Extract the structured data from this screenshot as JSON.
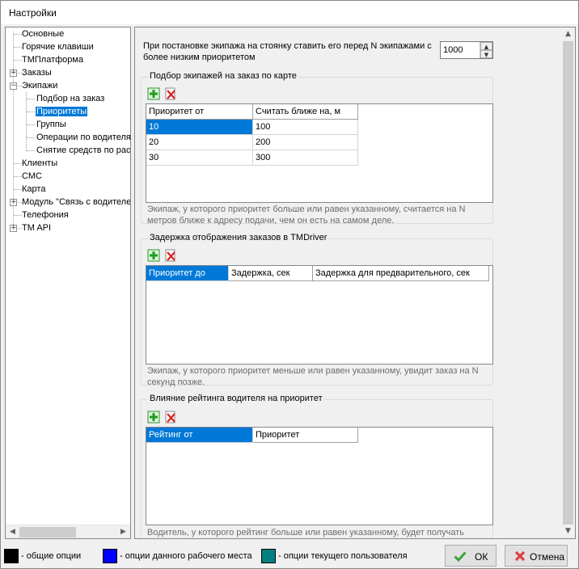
{
  "window": {
    "title": "Настройки"
  },
  "tree": {
    "items": [
      {
        "label": "Основные",
        "depth": 0,
        "expander": ""
      },
      {
        "label": "Горячие клавиши",
        "depth": 0,
        "expander": ""
      },
      {
        "label": "TMПлатформа",
        "depth": 0,
        "expander": ""
      },
      {
        "label": "Заказы",
        "depth": 0,
        "expander": "+"
      },
      {
        "label": "Экипажи",
        "depth": 0,
        "expander": "−"
      },
      {
        "label": "Подбор на заказ",
        "depth": 1,
        "expander": ""
      },
      {
        "label": "Приоритеты",
        "depth": 1,
        "expander": "",
        "selected": true
      },
      {
        "label": "Группы",
        "depth": 1,
        "expander": ""
      },
      {
        "label": "Операции по водителям",
        "depth": 1,
        "expander": ""
      },
      {
        "label": "Снятие средств по расписанию",
        "depth": 1,
        "expander": ""
      },
      {
        "label": "Клиенты",
        "depth": 0,
        "expander": ""
      },
      {
        "label": "СМС",
        "depth": 0,
        "expander": ""
      },
      {
        "label": "Карта",
        "depth": 0,
        "expander": ""
      },
      {
        "label": "Модуль \"Связь с водителем\"",
        "depth": 0,
        "expander": "+"
      },
      {
        "label": "Телефония",
        "depth": 0,
        "expander": ""
      },
      {
        "label": "TM API",
        "depth": 0,
        "expander": "+"
      }
    ]
  },
  "priority": {
    "text": "При постановке экипажа на стоянку ставить его перед N экипажами с более низким приоритетом",
    "value": "1000"
  },
  "group1": {
    "title": "Подбор экипажей на заказ по карте",
    "columns": [
      "Приоритет от",
      "Считать ближе на, м"
    ],
    "rows": [
      [
        "10",
        "100"
      ],
      [
        "20",
        "200"
      ],
      [
        "30",
        "300"
      ]
    ],
    "note": "Экипаж, у которого приоритет больше или равен указанному, считается на N метров ближе к адресу подачи, чем он есть на самом деле."
  },
  "group2": {
    "title": "Задержка отображения заказов в TMDriver",
    "columns": [
      "Приоритет до",
      "Задержка, сек",
      "Задержка для предварительного, сек"
    ],
    "note": "Экипаж, у которого приоритет меньше или равен указанному, увидит заказ на N секунд позже."
  },
  "group3": {
    "title": "Влияние рейтинга водителя на приоритет",
    "columns": [
      "Рейтинг от",
      "Приоритет"
    ],
    "note": "Водитель, у которого рейтинг больше или равен указанному, будет получать"
  },
  "legend": {
    "common": "- общие опции",
    "workplace": "- опции данного рабочего места",
    "user": "- опции текущего пользователя",
    "colors": {
      "common": "#000000",
      "workplace": "#0000ff",
      "user": "#008080"
    }
  },
  "buttons": {
    "ok": "ОК",
    "cancel": "Отмена"
  }
}
